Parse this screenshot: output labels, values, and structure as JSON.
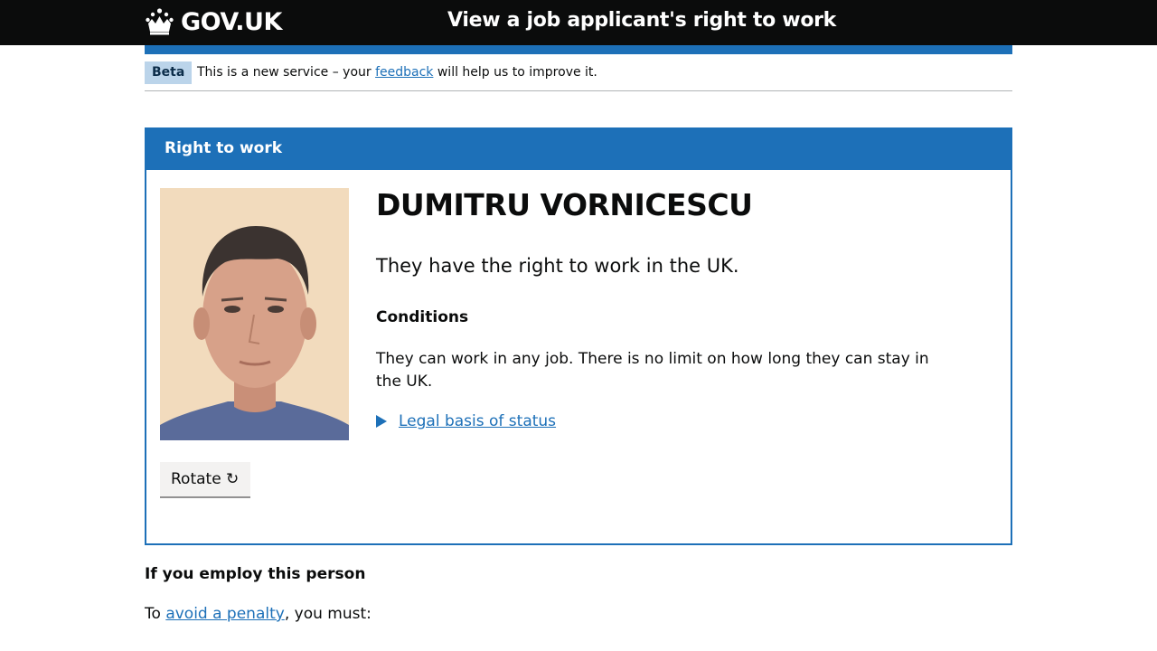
{
  "header": {
    "logo_text": "GOV.UK",
    "service_name": "View a job applicant's right to work"
  },
  "phase_banner": {
    "tag": "Beta",
    "text_before": "This is a new service – your ",
    "link_text": "feedback",
    "text_after": " will help us to improve it."
  },
  "panel": {
    "title": "Right to work",
    "photo_alt": "Photo of job applicant",
    "rotate_label": "Rotate ↻",
    "name": "DUMITRU VORNICESCU",
    "status": "They have the right to work in the UK.",
    "conditions_heading": "Conditions",
    "conditions_text": "They can work in any job. There is no limit on how long they can stay in the UK.",
    "legal_basis_label": "Legal basis of status"
  },
  "employment": {
    "heading": "If you employ this person",
    "penalty_before": "To ",
    "penalty_link": "avoid a penalty",
    "penalty_after": ", you must:"
  },
  "colors": {
    "header_bg": "#0b0c0c",
    "brand_blue": "#1d70b8",
    "beta_tag_bg": "#bbd4ea"
  }
}
